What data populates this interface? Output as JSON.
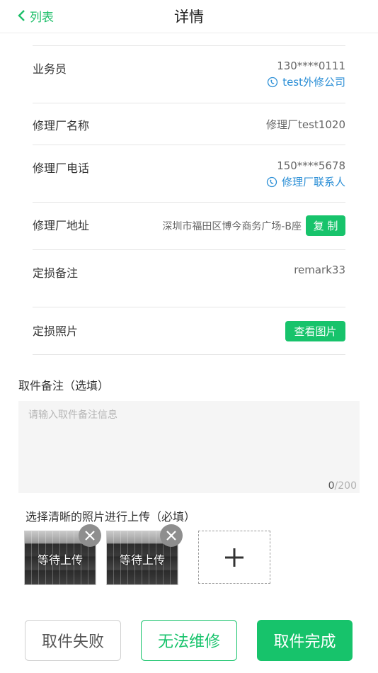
{
  "header": {
    "back_label": "列表",
    "title": "详情"
  },
  "details": {
    "salesman": {
      "label": "业务员",
      "phone": "130****0111",
      "contact": "test外修公司"
    },
    "factory_name": {
      "label": "修理厂名称",
      "value": "修理厂test1020"
    },
    "factory_phone": {
      "label": "修理厂电话",
      "phone": "150****5678",
      "contact": "修理厂联系人"
    },
    "factory_address": {
      "label": "修理厂地址",
      "value": "深圳市福田区博今商务广场-B座",
      "copy_label": "复 制"
    },
    "loss_remark": {
      "label": "定损备注",
      "value": "remark33"
    },
    "loss_photos": {
      "label": "定损照片",
      "button_label": "查看图片"
    }
  },
  "pickup_remark": {
    "title": "取件备注（选填）",
    "placeholder": "请输入取件备注信息",
    "value": "",
    "count": "0",
    "max": "/200"
  },
  "upload": {
    "title": "选择清晰的照片进行上传（必填）",
    "photos": [
      {
        "status": "等待上传"
      },
      {
        "status": "等待上传"
      }
    ]
  },
  "actions": {
    "fail_label": "取件失败",
    "cannot_repair_label": "无法维修",
    "complete_label": "取件完成"
  },
  "colors": {
    "accent": "#17c36b",
    "link": "#2c8fd6"
  }
}
